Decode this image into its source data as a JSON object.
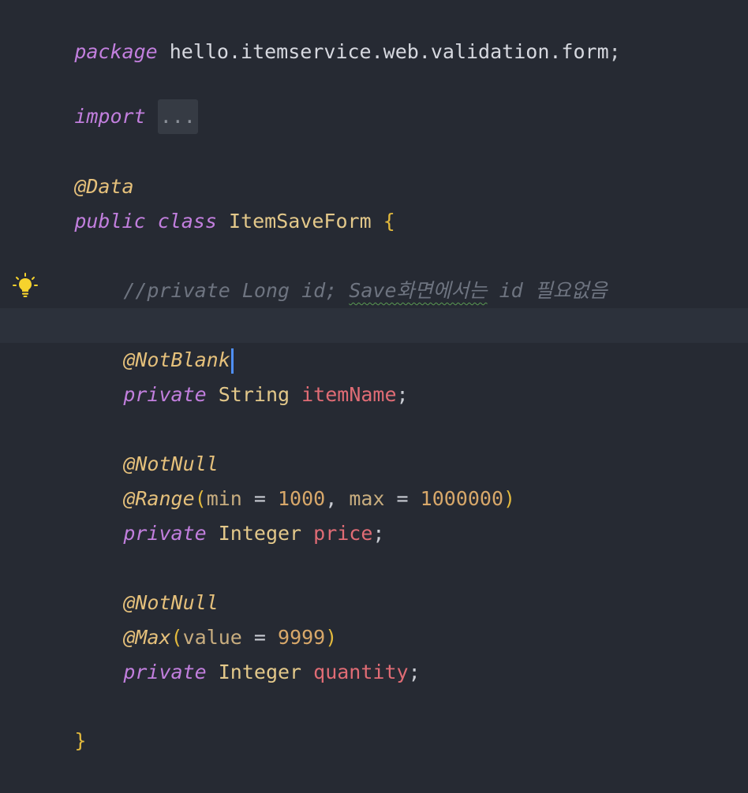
{
  "code": {
    "package": {
      "keyword": "package",
      "name": " hello.itemservice.web.validation.form",
      "semicolon": ";"
    },
    "import": {
      "keyword": "import",
      "folded": "..."
    },
    "class_annotation": "@Data",
    "class_decl": {
      "kw_public": "public",
      "kw_class": "class",
      "name": "ItemSaveForm",
      "open_brace": "{"
    },
    "comment": {
      "prefix": "//private Long id; ",
      "squiggled": "Save화면에서는",
      "suffix": " id 필요없음"
    },
    "fields": [
      {
        "annotations": [
          {
            "name": "@NotBlank"
          }
        ],
        "modifier": "private",
        "type": "String",
        "name": "itemName"
      },
      {
        "annotations": [
          {
            "name": "@NotNull"
          },
          {
            "name": "@Range",
            "args": "(min = 1000, max = 1000000)"
          }
        ],
        "modifier": "private",
        "type": "Integer",
        "name": "price"
      },
      {
        "annotations": [
          {
            "name": "@NotNull"
          },
          {
            "name": "@Max",
            "args": "(value = 9999)"
          }
        ],
        "modifier": "private",
        "type": "Integer",
        "name": "quantity"
      }
    ],
    "close_brace": "}"
  },
  "icons": {
    "intention": "lightbulb-icon"
  },
  "colors": {
    "background": "#262a33",
    "keyword": "#c27fde",
    "annotation": "#e5c07b",
    "field": "#e06c75",
    "comment": "#6e7480",
    "caret": "#4f8ff7"
  }
}
